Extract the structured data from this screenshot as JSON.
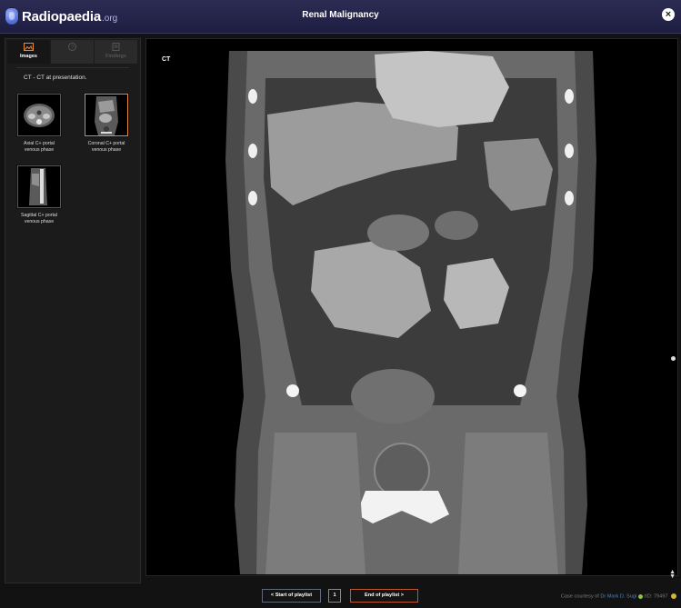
{
  "header": {
    "logo_name": "Radiopaedia",
    "logo_domain": ".org",
    "title": "Renal Malignancy",
    "close_label": "×"
  },
  "sidebar": {
    "tabs": [
      {
        "label": "Images",
        "icon": "images-icon",
        "active": true
      },
      {
        "label": "",
        "icon": "help-icon",
        "active": false
      },
      {
        "label": "Findings",
        "icon": "findings-icon",
        "active": false
      }
    ],
    "study_label": "CT - CT at presentation.",
    "series": [
      {
        "label_line1": "Axial C+ portal",
        "label_line2": "venous phase",
        "active": false
      },
      {
        "label_line1": "Coronal C+ portal",
        "label_line2": "venous phase",
        "active": true
      },
      {
        "label_line1": "Sagittal C+ portal",
        "label_line2": "venous phase",
        "active": false
      }
    ]
  },
  "viewer": {
    "modality_label": "CT"
  },
  "footer": {
    "start_label": "<  Start of playlist",
    "page_number": "1",
    "end_label": "End of playlist  >",
    "credit_prefix": "Case courtesy of ",
    "credit_author": "Dr Mark D. Sugi",
    "credit_rid": "rID: 79497"
  },
  "colors": {
    "header_bg": "#24234a",
    "accent_orange": "#e28b3c",
    "link_blue": "#4d86c8"
  }
}
